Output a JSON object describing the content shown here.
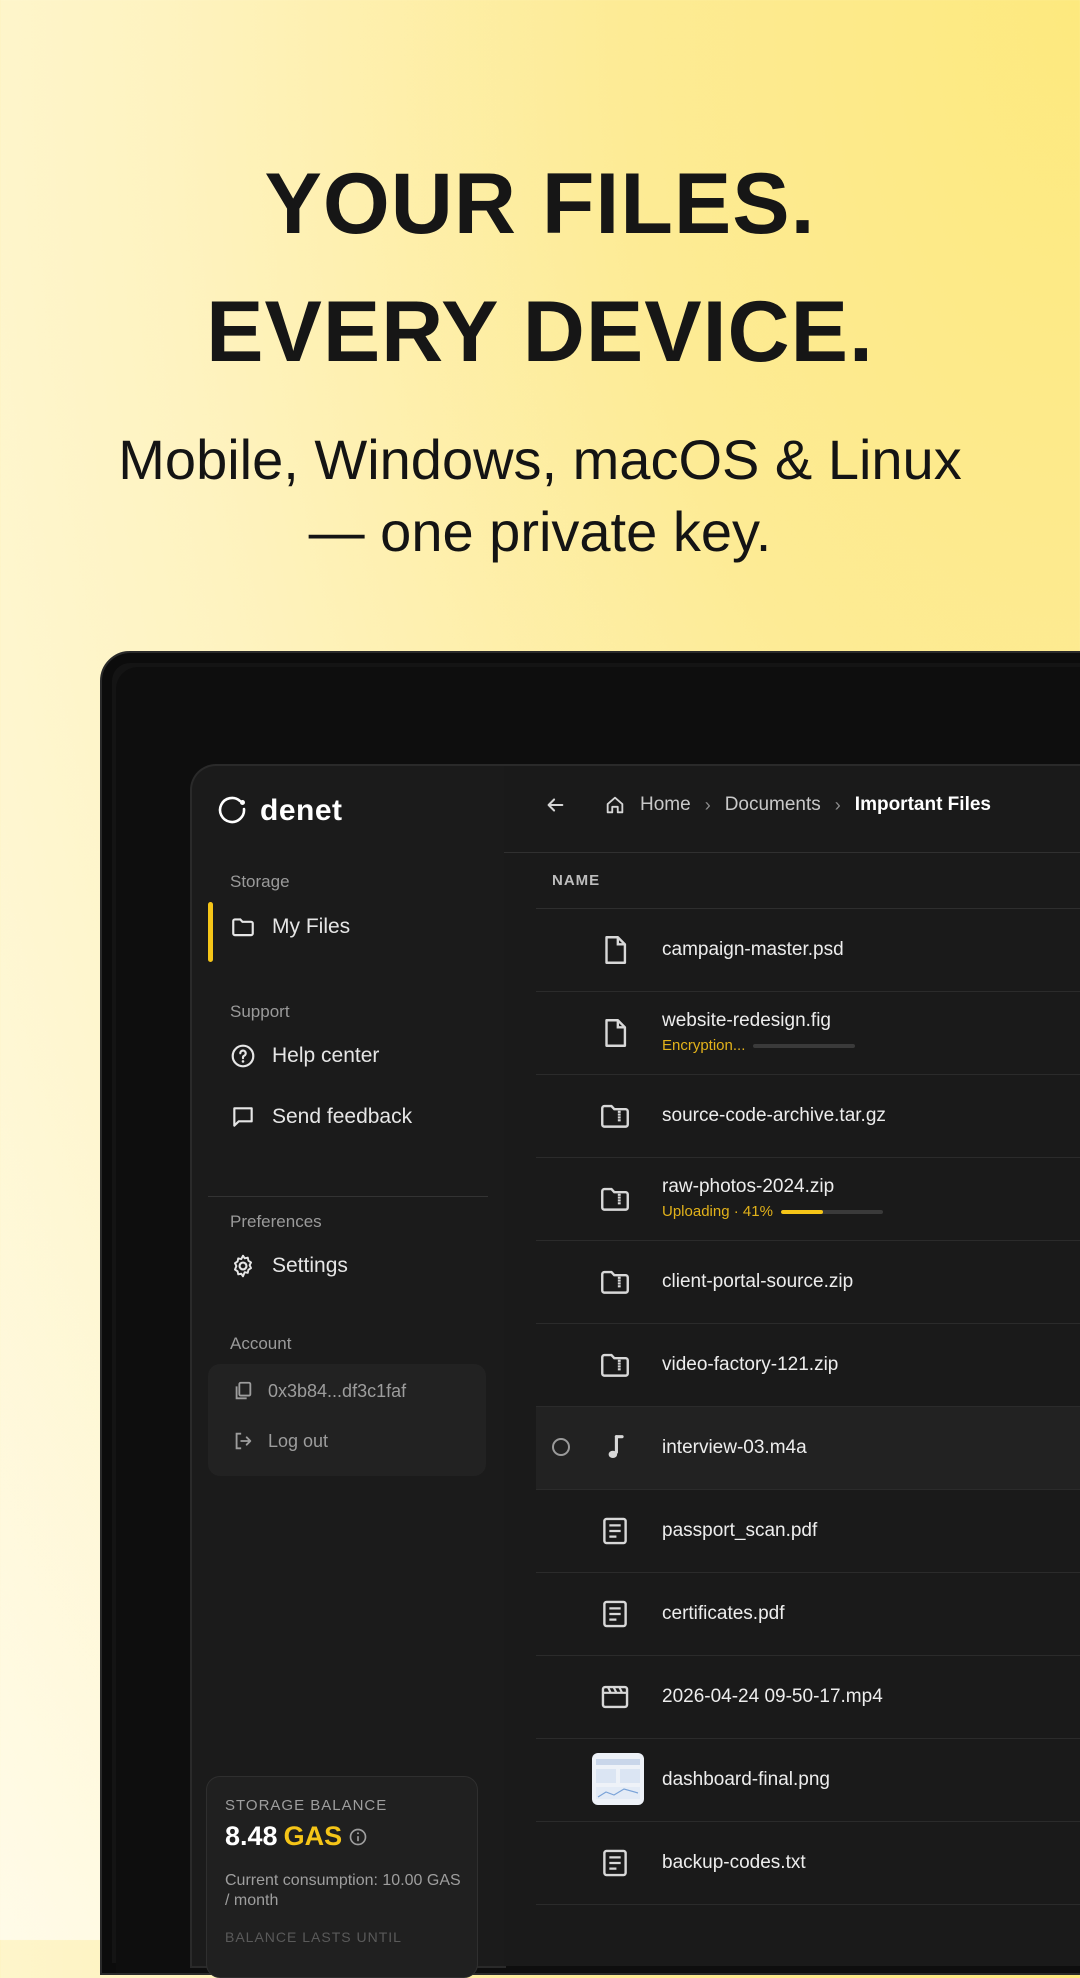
{
  "hero": {
    "line1": "YOUR FILES.",
    "line2": "EVERY DEVICE.",
    "sub1": "Mobile, Windows, macOS & Linux",
    "sub2": "— one private key."
  },
  "app": {
    "brand": "denet",
    "accent": "#f5c518",
    "sidebar": {
      "storage_label": "Storage",
      "my_files": "My Files",
      "support_label": "Support",
      "help_center": "Help center",
      "send_feedback": "Send feedback",
      "preferences_label": "Preferences",
      "settings": "Settings",
      "account_label": "Account",
      "wallet": "0x3b84...df3c1faf",
      "logout": "Log out"
    },
    "balance": {
      "label": "STORAGE BALANCE",
      "amount": "8.48",
      "unit": "GAS",
      "consumption": "Current consumption: 10.00 GAS / month",
      "lasts_label": "BALANCE LASTS UNTIL"
    },
    "breadcrumb": {
      "home": "Home",
      "documents": "Documents",
      "current": "Important Files"
    },
    "table": {
      "col_name": "NAME",
      "files": [
        {
          "name": "campaign-master.psd",
          "icon": "file-icon"
        },
        {
          "name": "website-redesign.fig",
          "icon": "file-icon",
          "status": "Encryption...",
          "progress": 0
        },
        {
          "name": "source-code-archive.tar.gz",
          "icon": "zip-folder-icon"
        },
        {
          "name": "raw-photos-2024.zip",
          "icon": "zip-folder-icon",
          "status": "Uploading · 41%",
          "progress": 0.41
        },
        {
          "name": "client-portal-source.zip",
          "icon": "zip-folder-icon"
        },
        {
          "name": "video-factory-121.zip",
          "icon": "zip-folder-icon"
        },
        {
          "name": "interview-03.m4a",
          "icon": "music-note-icon"
        },
        {
          "name": "passport_scan.pdf",
          "icon": "document-icon"
        },
        {
          "name": "certificates.pdf",
          "icon": "document-icon"
        },
        {
          "name": "2026-04-24 09-50-17.mp4",
          "icon": "video-clapper-icon"
        },
        {
          "name": "dashboard-final.png",
          "icon": "image-thumbnail"
        },
        {
          "name": "backup-codes.txt",
          "icon": "document-icon"
        }
      ]
    }
  }
}
